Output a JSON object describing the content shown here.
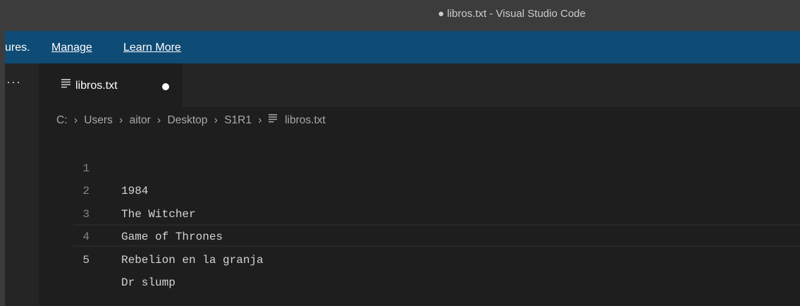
{
  "window": {
    "title": "● libros.txt - Visual Studio Code"
  },
  "banner": {
    "partial_text": "ures.",
    "manage_link": "Manage",
    "learn_more_link": "Learn More"
  },
  "sidebar": {
    "more_actions": "···"
  },
  "tabs": [
    {
      "label": "libros.txt",
      "icon": "text-file-icon",
      "dirty": true
    }
  ],
  "breadcrumb": {
    "items": [
      "C:",
      "Users",
      "aitor",
      "Desktop",
      "S1R1",
      "libros.txt"
    ],
    "separator": "›"
  },
  "editor": {
    "lines": [
      {
        "number": "1",
        "text": "1984"
      },
      {
        "number": "2",
        "text": "The Witcher"
      },
      {
        "number": "3",
        "text": "Game of Thrones"
      },
      {
        "number": "4",
        "text": "Rebelion en la granja"
      },
      {
        "number": "5",
        "text": "Dr slump"
      }
    ],
    "current_line": 5
  },
  "colors": {
    "titlebar": "#3c3c3c",
    "banner": "#0e4b75",
    "editor_bg": "#1e1e1e",
    "tabbar_bg": "#252526"
  }
}
